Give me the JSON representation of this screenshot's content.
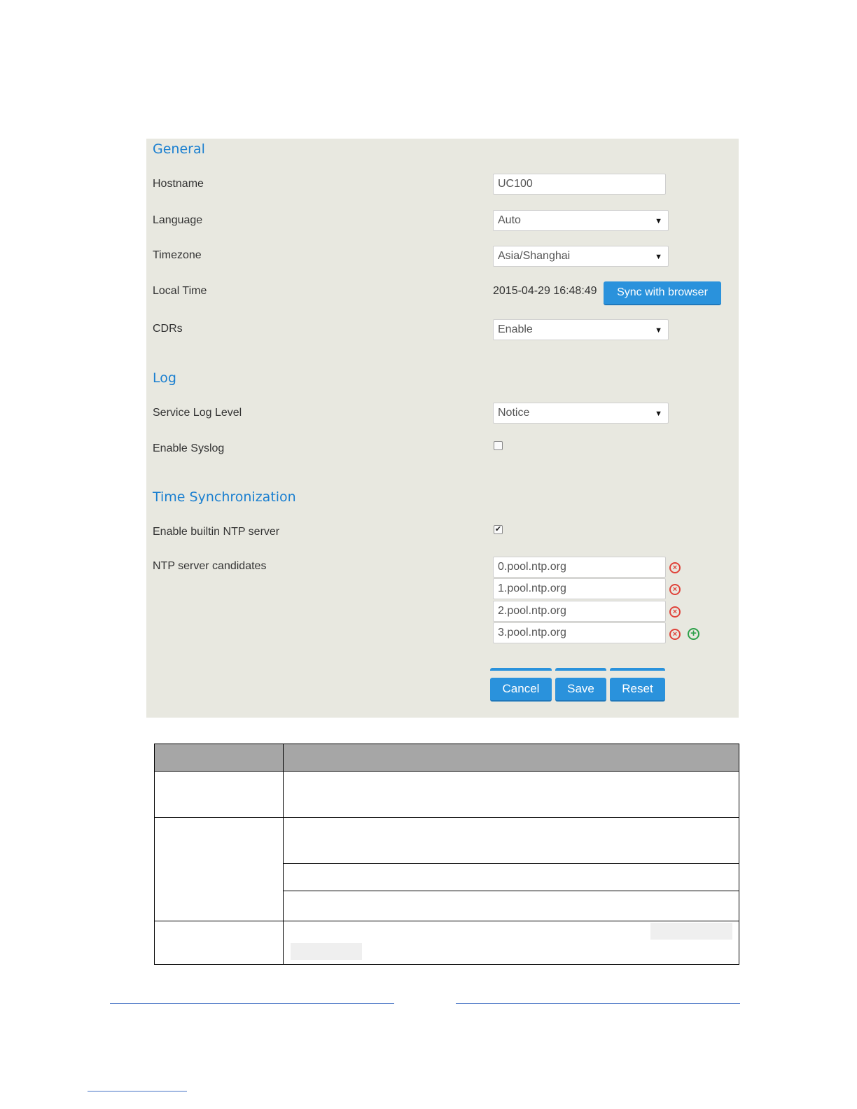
{
  "general": {
    "title": "General",
    "hostname_label": "Hostname",
    "hostname_value": "UC100",
    "language_label": "Language",
    "language_value": "Auto",
    "timezone_label": "Timezone",
    "timezone_value": "Asia/Shanghai",
    "local_time_label": "Local Time",
    "local_time_value": "2015-04-29 16:48:49",
    "sync_button": "Sync with browser",
    "cdrs_label": "CDRs",
    "cdrs_value": "Enable"
  },
  "log": {
    "title": "Log",
    "service_log_level_label": "Service Log Level",
    "service_log_level_value": "Notice",
    "enable_syslog_label": "Enable Syslog",
    "enable_syslog_checked": false
  },
  "time_sync": {
    "title": "Time Synchronization",
    "builtin_ntp_label": "Enable builtin NTP server",
    "builtin_ntp_checked": true,
    "ntp_candidates_label": "NTP server candidates",
    "ntp_servers": [
      "0.pool.ntp.org",
      "1.pool.ntp.org",
      "2.pool.ntp.org",
      "3.pool.ntp.org"
    ]
  },
  "actions": {
    "cancel": "Cancel",
    "save": "Save",
    "reset": "Reset"
  },
  "icons": {
    "dropdown": "caret-down-icon",
    "remove": "remove-circle-icon",
    "add": "add-circle-icon"
  },
  "colors": {
    "accent": "#2a92dc",
    "heading": "#1a7fd0",
    "remove": "#e0433a",
    "add": "#2ea04a",
    "panel_bg": "#e8e8e0"
  }
}
